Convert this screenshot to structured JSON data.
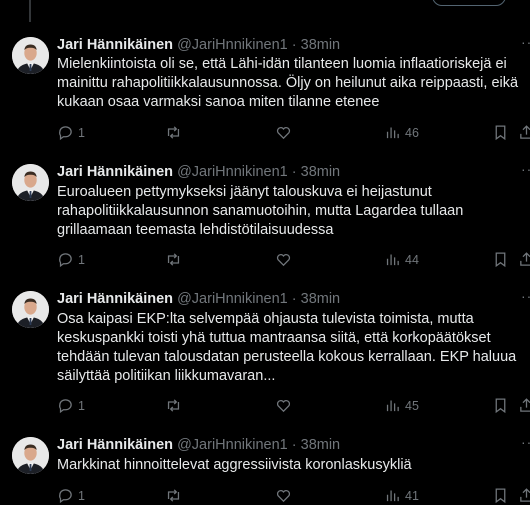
{
  "tweets": [
    {
      "name": "Jari Hännikäinen",
      "handle": "@JariHnnikinen1",
      "separator": "·",
      "time": "38min",
      "text": "Mielenkiintoista oli se, että Lähi-idän tilanteen luomia inflaatioriskejä ei mainittu rahapolitiikkalausunnossa. Öljy on heilunut aika reippaasti, eikä kukaan osaa varmaksi sanoa miten tilanne etenee",
      "replies": "1",
      "retweets": "",
      "likes": "",
      "views": "46"
    },
    {
      "name": "Jari Hännikäinen",
      "handle": "@JariHnnikinen1",
      "separator": "·",
      "time": "38min",
      "text": "Euroalueen pettymykseksi jäänyt talouskuva ei heijastunut rahapolitiikkalausunnon sanamuotoihin, mutta Lagardea tullaan grillaamaan teemasta lehdistötilaisuudessa",
      "replies": "1",
      "retweets": "",
      "likes": "",
      "views": "44"
    },
    {
      "name": "Jari Hännikäinen",
      "handle": "@JariHnnikinen1",
      "separator": "·",
      "time": "38min",
      "text": "Osa kaipasi EKP:lta selvempää ohjausta tulevista toimista, mutta keskuspankki toisti yhä tuttua mantraansa siitä, että korkopäätökset tehdään tulevan talousdatan perusteella kokous kerrallaan. EKP haluua säilyttää politiikan liikkumavaran...",
      "replies": "1",
      "retweets": "",
      "likes": "",
      "views": "45"
    },
    {
      "name": "Jari Hännikäinen",
      "handle": "@JariHnnikinen1",
      "separator": "·",
      "time": "38min",
      "text": "Markkinat hinnoittelevat aggressiivista koronlaskusykliä",
      "replies": "1",
      "retweets": "",
      "likes": "",
      "views": "41"
    }
  ]
}
